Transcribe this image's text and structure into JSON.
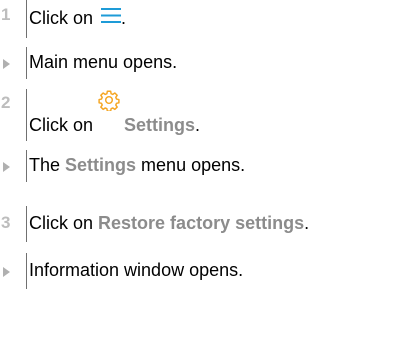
{
  "steps": [
    {
      "kind": "number",
      "marker": "1",
      "before": "Click on ",
      "icon": "hamburger-menu-icon",
      "after": "."
    },
    {
      "kind": "result",
      "text": "Main menu opens."
    },
    {
      "kind": "number",
      "marker": "2",
      "before": "Click on ",
      "icon": "gear-icon",
      "highlight": "Settings",
      "after": "."
    },
    {
      "kind": "result",
      "before": "The ",
      "highlight": "Settings",
      "after": " menu opens."
    },
    {
      "kind": "number",
      "marker": "3",
      "before": "Click on ",
      "highlight": "Restore factory settings",
      "after": "."
    },
    {
      "kind": "result",
      "text": "Information window opens."
    }
  ],
  "colors": {
    "highlight": "#8c8c8c",
    "icon_blue": "#1e9bd7",
    "gear_orange": "#f5a623",
    "marker": "#bdbdbd"
  }
}
